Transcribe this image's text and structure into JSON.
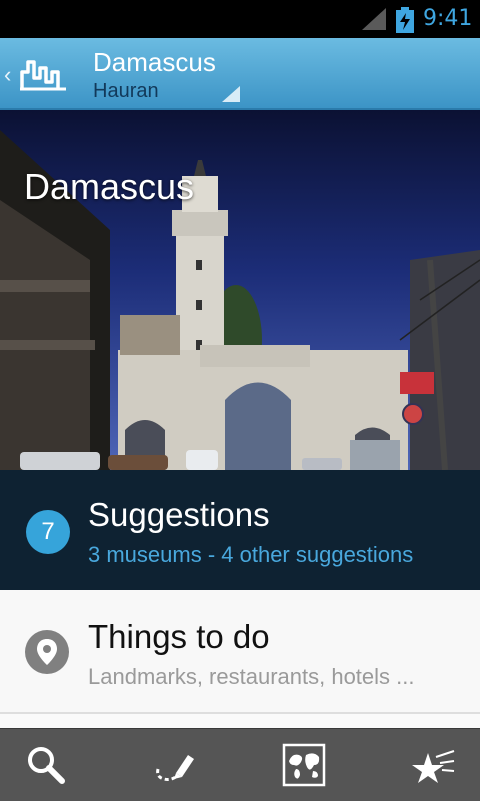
{
  "status_bar": {
    "time": "9:41"
  },
  "action_bar": {
    "title": "Damascus",
    "subtitle": "Hauran"
  },
  "hero": {
    "caption": "Damascus"
  },
  "suggestions": {
    "count": "7",
    "title": "Suggestions",
    "subtitle": "3 museums - 4 other suggestions"
  },
  "things_to_do": {
    "title": "Things to do",
    "subtitle": "Landmarks, restaurants, hotels ..."
  },
  "bottom_bar": {
    "items": [
      "search-icon",
      "itinerary-icon",
      "map-icon",
      "favorites-icon"
    ]
  },
  "colors": {
    "action_bar": "#4aa5d4",
    "suggestions_bg": "#0e2232",
    "accent": "#36a4da",
    "bottom_bar": "#555555"
  }
}
